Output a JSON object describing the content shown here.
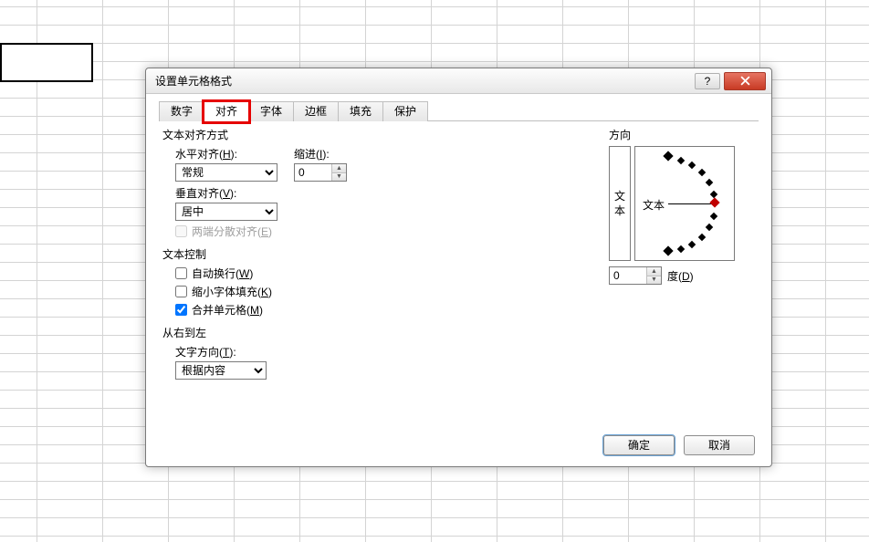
{
  "dialog": {
    "title": "设置单元格格式",
    "help_tooltip": "?",
    "close_tooltip": "关闭"
  },
  "tabs": [
    "数字",
    "对齐",
    "字体",
    "边框",
    "填充",
    "保护"
  ],
  "active_tab_index": 1,
  "text_alignment": {
    "section_label": "文本对齐方式",
    "horizontal_label": "水平对齐(H):",
    "horizontal_value": "常规",
    "vertical_label": "垂直对齐(V):",
    "vertical_value": "居中",
    "indent_label": "缩进(I):",
    "indent_value": "0",
    "distributed_label": "两端分散对齐(E)",
    "distributed_checked": false,
    "distributed_disabled": true
  },
  "text_control": {
    "section_label": "文本控制",
    "wrap_label": "自动换行(W)",
    "wrap_checked": false,
    "shrink_label": "缩小字体填充(K)",
    "shrink_checked": false,
    "merge_label": "合并单元格(M)",
    "merge_checked": true
  },
  "rtl": {
    "section_label": "从右到左",
    "direction_label": "文字方向(T):",
    "direction_value": "根据内容"
  },
  "orientation": {
    "section_label": "方向",
    "vertical_text": "文本",
    "dial_text": "文本",
    "degree_value": "0",
    "degree_label": "度(D)"
  },
  "buttons": {
    "ok": "确定",
    "cancel": "取消"
  }
}
